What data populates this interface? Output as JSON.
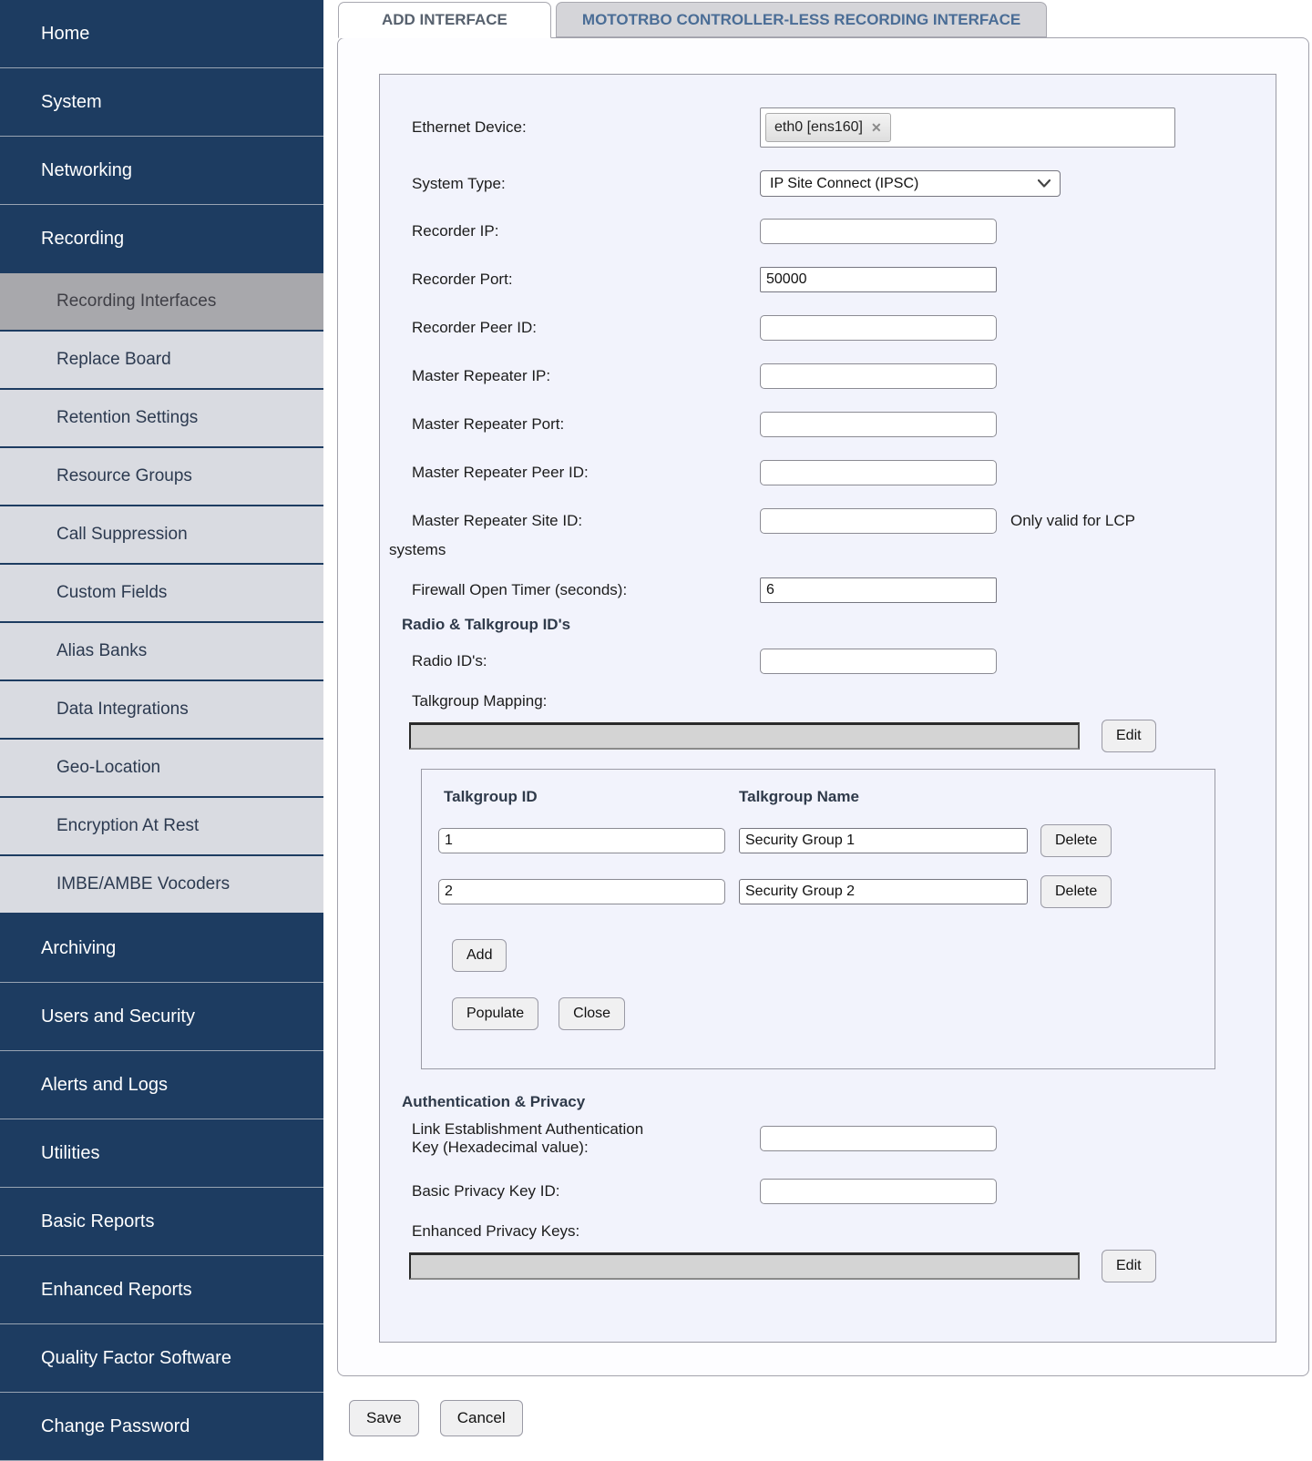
{
  "sidebar": {
    "top": [
      "Home",
      "System",
      "Networking",
      "Recording"
    ],
    "sub": [
      "Recording Interfaces",
      "Replace Board",
      "Retention Settings",
      "Resource Groups",
      "Call Suppression",
      "Custom Fields",
      "Alias Banks",
      "Data Integrations",
      "Geo-Location",
      "Encryption At Rest",
      "IMBE/AMBE Vocoders"
    ],
    "selected_sub_item": "Recording Interfaces",
    "bottom": [
      "Archiving",
      "Users and Security",
      "Alerts and Logs",
      "Utilities",
      "Basic Reports",
      "Enhanced Reports",
      "Quality Factor Software",
      "Change Password"
    ]
  },
  "tabs": {
    "add_interface": "ADD INTERFACE",
    "mototrbo": "MOTOTRBO CONTROLLER-LESS RECORDING INTERFACE"
  },
  "form": {
    "ethernet_device": {
      "label": "Ethernet Device:",
      "tag": "eth0 [ens160]",
      "remove_icon": "✕"
    },
    "system_type": {
      "label": "System Type:",
      "value": "IP Site Connect (IPSC)"
    },
    "recorder_ip": {
      "label": "Recorder IP:",
      "value": ""
    },
    "recorder_port": {
      "label": "Recorder Port:",
      "value": "50000"
    },
    "recorder_peer_id": {
      "label": "Recorder Peer ID:",
      "value": ""
    },
    "master_repeater_ip": {
      "label": "Master Repeater IP:",
      "value": ""
    },
    "master_repeater_port": {
      "label": "Master Repeater Port:",
      "value": ""
    },
    "master_repeater_peer_id": {
      "label": "Master Repeater Peer ID:",
      "value": ""
    },
    "master_repeater_site_id": {
      "label": "Master Repeater Site ID:",
      "value": "",
      "note_right": "Only valid for LCP",
      "note_wrap": "systems"
    },
    "firewall_open_timer": {
      "label": "Firewall Open Timer (seconds):",
      "value": "6"
    },
    "radio_talkgroup_header": "Radio & Talkgroup ID's",
    "radio_ids": {
      "label": "Radio ID's:",
      "value": ""
    },
    "talkgroup_mapping_label": "Talkgroup Mapping:",
    "talkgroup_edit_button": "Edit",
    "talkgroup_table": {
      "col_id": "Talkgroup ID",
      "col_name": "Talkgroup Name",
      "rows": [
        {
          "id": "1",
          "name": "Security Group 1"
        },
        {
          "id": "2",
          "name": "Security Group 2"
        }
      ],
      "delete_button": "Delete",
      "add_button": "Add",
      "populate_button": "Populate",
      "close_button": "Close"
    },
    "auth_header": "Authentication & Privacy",
    "link_key": {
      "label_line1": "Link Establishment Authentication",
      "label_line2": "Key (Hexadecimal value):",
      "value": ""
    },
    "basic_privacy_key_id": {
      "label": "Basic Privacy Key ID:",
      "value": ""
    },
    "enhanced_privacy_keys_label": "Enhanced Privacy Keys:",
    "enhanced_edit_button": "Edit"
  },
  "actions": {
    "save": "Save",
    "cancel": "Cancel"
  },
  "colors": {
    "sidebar_navy": "#1d3c61",
    "subitem_bg": "#d9dbe1",
    "subitem_selected_bg": "#a8a8ac",
    "form_bg": "#f2f3fc",
    "tab_inactive_bg": "#d5d5d9",
    "tab_active_text": "#57616e",
    "tab_inactive_text": "#4a6d96"
  }
}
